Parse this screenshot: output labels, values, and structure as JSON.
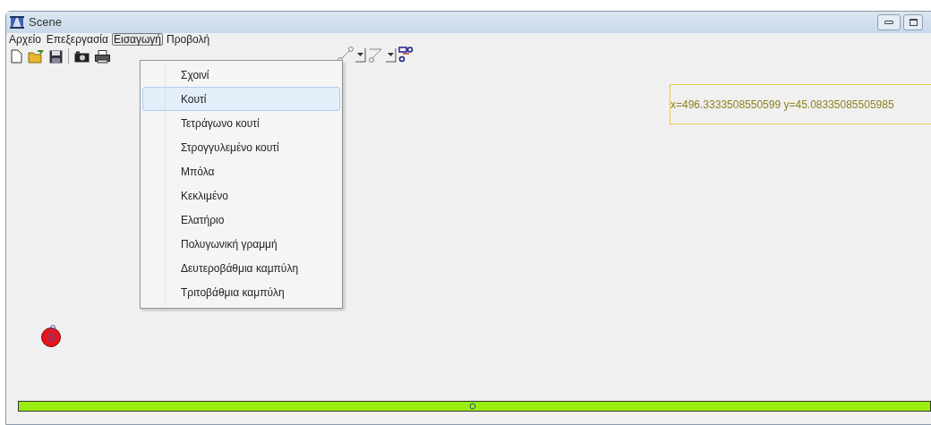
{
  "window": {
    "title": "Scene"
  },
  "menu_bar": [
    {
      "label": "Αρχείο",
      "selected": false
    },
    {
      "label": "Επεξεργασία",
      "selected": false
    },
    {
      "label": "Εισαγωγή",
      "selected": true
    },
    {
      "label": "Προβολή",
      "selected": false
    }
  ],
  "dropdown_menu": [
    {
      "label": "Σχοινί",
      "selected": false
    },
    {
      "label": "Κουτί",
      "selected": true
    },
    {
      "label": "Τετράγωνο κουτί",
      "selected": false
    },
    {
      "label": "Στρογγυλεμένο κουτί",
      "selected": false
    },
    {
      "label": "Μπόλα",
      "selected": false
    },
    {
      "label": "Κεκλιμένο",
      "selected": false
    },
    {
      "label": "Ελατήριο",
      "selected": false
    },
    {
      "label": "Πολυγωνική γραμμή",
      "selected": false
    },
    {
      "label": "Δευτεροβάθμια καμπύλη",
      "selected": false
    },
    {
      "label": "Τριτοβάθμια καμπύλη",
      "selected": false
    }
  ],
  "coordinates": "x=496.3333508550599 y=45.08335085505985"
}
